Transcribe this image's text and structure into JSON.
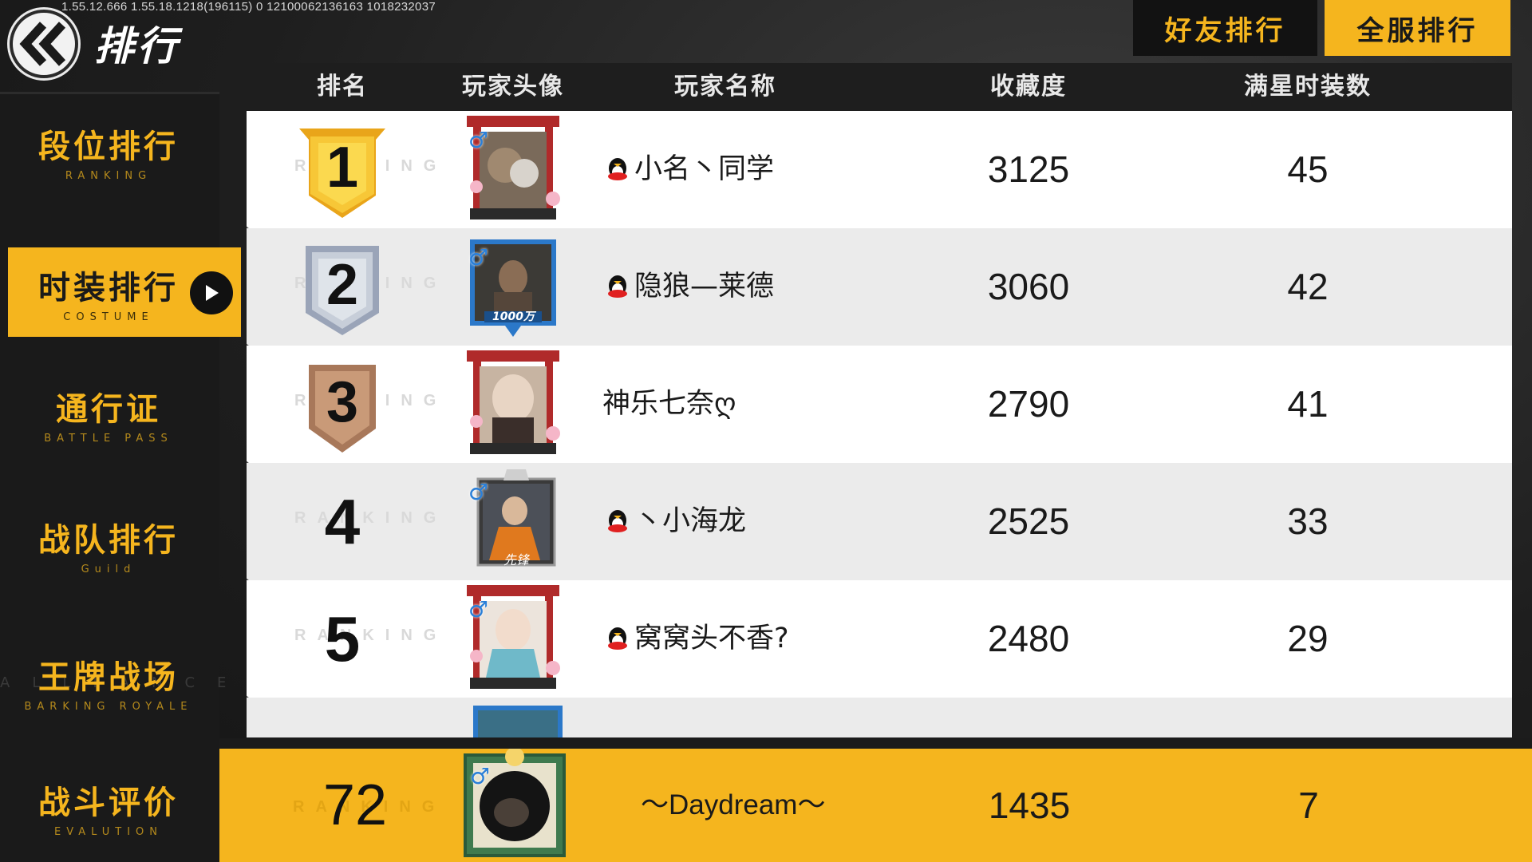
{
  "version_text": "1.55.12.666  1.55.18.1218(196115)  0  12100062136163    1018232037",
  "title": "排行",
  "sidebar": {
    "items": [
      {
        "cn": "段位排行",
        "en": "RANKING",
        "active": false
      },
      {
        "cn": "时装排行",
        "en": "COSTUME",
        "active": true
      },
      {
        "cn": "通行证",
        "en": "BATTLE PASS",
        "active": false
      },
      {
        "cn": "战队排行",
        "en": "Guild",
        "active": false
      },
      {
        "cn": "王牌战场",
        "en": "BARKING ROYALE",
        "active": false
      },
      {
        "cn": "战斗评价",
        "en": "EVALUTION",
        "active": false
      }
    ]
  },
  "tabs": {
    "friends": "好友排行",
    "server": "全服排行"
  },
  "table": {
    "headers": {
      "rank": "排名",
      "avatar": "玩家头像",
      "name": "玩家名称",
      "collection": "收藏度",
      "full_star": "满星时装数"
    },
    "rows": [
      {
        "rank": "1",
        "name": "小名丶同学",
        "qq": true,
        "collection": "3125",
        "full_star": "45"
      },
      {
        "rank": "2",
        "name": "隐狼—莱德",
        "qq": true,
        "collection": "3060",
        "full_star": "42"
      },
      {
        "rank": "3",
        "name": "神乐七奈ღ",
        "qq": false,
        "collection": "2790",
        "full_star": "41"
      },
      {
        "rank": "4",
        "name": "丶小海龙",
        "qq": true,
        "collection": "2525",
        "full_star": "33"
      },
      {
        "rank": "5",
        "name": "窝窝头不香?",
        "qq": true,
        "collection": "2480",
        "full_star": "29"
      }
    ],
    "avatar_tags": {
      "row2": "1000万",
      "row4": "先锋"
    },
    "watermark": "RANKING"
  },
  "my_row": {
    "rank": "72",
    "name": "～Daydream～",
    "collection": "1435",
    "full_star": "7"
  },
  "colors": {
    "accent": "#f5b51e",
    "dark": "#1a1a1a",
    "gender": "#2a7fd8"
  }
}
